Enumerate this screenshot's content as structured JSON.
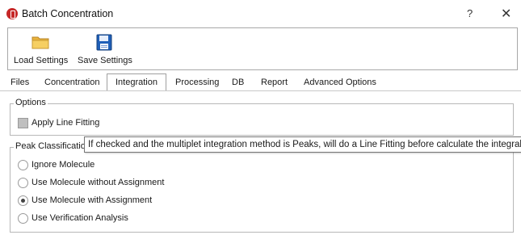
{
  "window": {
    "title": "Batch Concentration",
    "help_label": "?",
    "close_label": "✕"
  },
  "toolbar": {
    "load_label": "Load Settings",
    "save_label": "Save Settings"
  },
  "tabs": [
    {
      "label": "Files",
      "active": false
    },
    {
      "label": "Concentration",
      "active": false
    },
    {
      "label": "Integration",
      "active": true
    },
    {
      "label": "Processing",
      "active": false
    },
    {
      "label": "DB",
      "active": false
    },
    {
      "label": "Report",
      "active": false
    },
    {
      "label": "Advanced Options",
      "active": false
    }
  ],
  "options_group": {
    "legend": "Options",
    "apply_line_fitting": {
      "label": "Apply Line Fitting",
      "checked": false
    }
  },
  "peak_group": {
    "legend": "Peak Classification",
    "radios": [
      {
        "label": "Ignore Molecule",
        "checked": false
      },
      {
        "label": "Use Molecule without Assignment",
        "checked": false
      },
      {
        "label": "Use Molecule with Assignment",
        "checked": true
      },
      {
        "label": "Use Verification Analysis",
        "checked": false
      }
    ]
  },
  "tooltip": {
    "text": "If checked and the multiplet integration method is Peaks, will do a Line Fitting before calculate the integrals"
  },
  "colors": {
    "app_icon": "#c62828",
    "save_icon": "#1a5fb4",
    "folder_icon": "#f2c14e"
  },
  "icons": {
    "app": "app-logo-icon",
    "load": "folder-icon",
    "save": "floppy-disk-icon"
  }
}
